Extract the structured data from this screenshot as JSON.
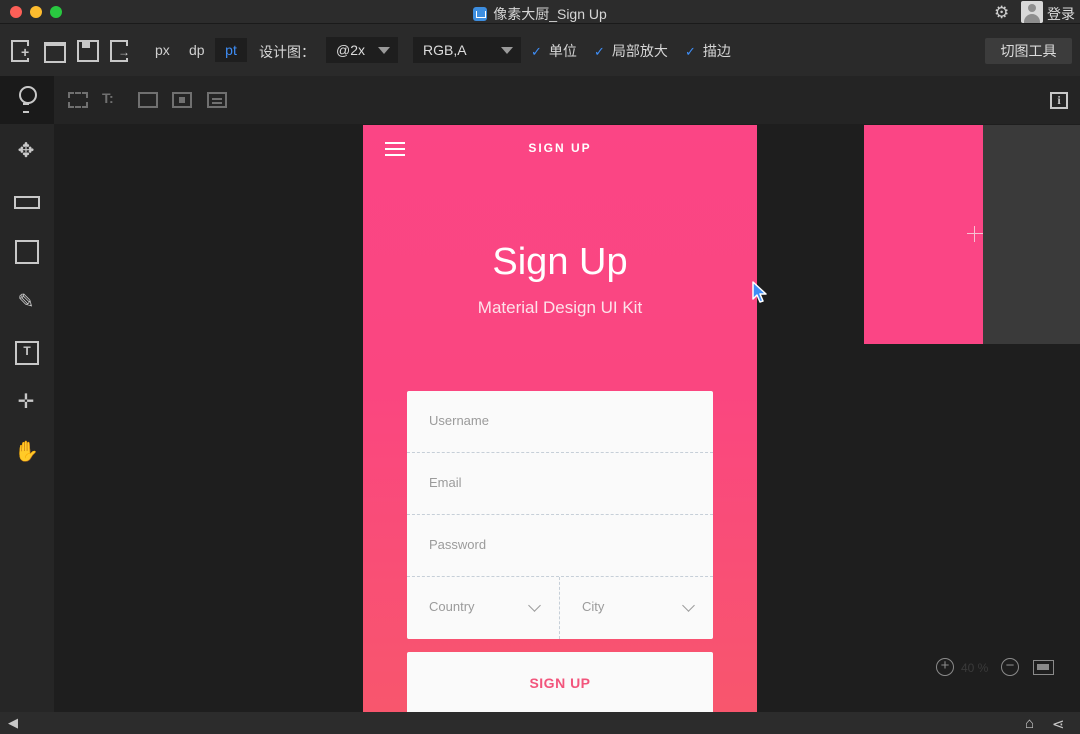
{
  "window": {
    "title": "像素大厨_Sign Up",
    "login_label": "登录"
  },
  "toolbar": {
    "units": [
      "px",
      "dp",
      "pt"
    ],
    "active_unit": "pt",
    "design_label": "设计图：",
    "scale_value": "@2x",
    "color_format_value": "RGB,A",
    "checks": [
      {
        "label": "单位",
        "checked": true
      },
      {
        "label": "局部放大",
        "checked": true
      },
      {
        "label": "描边",
        "checked": true
      }
    ],
    "slice_tool_label": "切图工具"
  },
  "artboard": {
    "header_title": "SIGN UP",
    "title": "Sign Up",
    "subtitle": "Material Design UI Kit",
    "fields": {
      "username_placeholder": "Username",
      "email_placeholder": "Email",
      "password_placeholder": "Password",
      "country_placeholder": "Country",
      "city_placeholder": "City"
    },
    "button_label": "SIGN UP",
    "gradient_top": "#fb4585",
    "gradient_bottom": "#f8566d"
  },
  "zoom": {
    "value": "40 %"
  },
  "colors": {
    "accent_blue": "#3e8ef7",
    "brand_pink": "#fb4585"
  }
}
